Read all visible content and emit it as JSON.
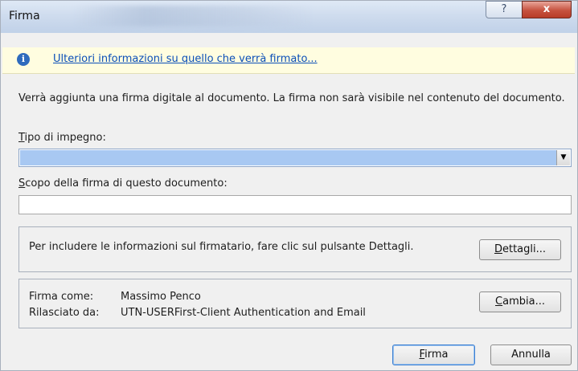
{
  "window": {
    "title": "Firma",
    "help_symbol": "?",
    "close_symbol": "x"
  },
  "infobar": {
    "icon": "info-icon",
    "icon_glyph": "i",
    "link_text": "Ulteriori informazioni su quello che verrà firmato..."
  },
  "description": "Verrà aggiunta una firma digitale al documento. La firma non sarà visibile nel contenuto del documento.",
  "commitment": {
    "label_accel": "T",
    "label_rest": "ipo di impegno:",
    "value": "",
    "arrow": "▼"
  },
  "purpose": {
    "label_accel": "S",
    "label_rest": "copo della firma di questo documento:",
    "value": ""
  },
  "details_group": {
    "text": "Per includere le informazioni sul firmatario, fare clic sul pulsante Dettagli.",
    "button_accel": "D",
    "button_rest": "ettagli..."
  },
  "signer_group": {
    "sign_as_label": "Firma come:",
    "sign_as_value": "Massimo Penco",
    "issued_by_label": "Rilasciato da:",
    "issued_by_value": "UTN-USERFirst-Client Authentication and Email",
    "change_accel": "C",
    "change_rest": "ambia..."
  },
  "footer": {
    "sign_accel": "F",
    "sign_rest": "irma",
    "cancel_label": "Annulla"
  }
}
